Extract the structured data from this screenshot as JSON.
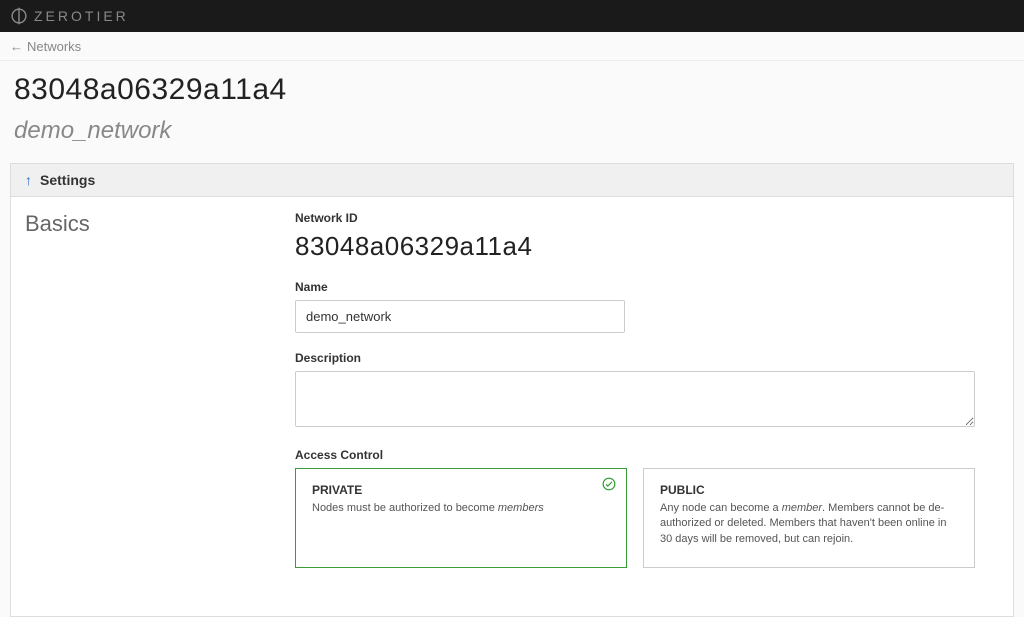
{
  "brand": {
    "name": "ZEROTIER"
  },
  "breadcrumb": {
    "back_label": "Networks"
  },
  "header": {
    "network_id": "83048a06329a11a4",
    "network_name": "demo_network"
  },
  "settings": {
    "heading": "Settings",
    "section": "Basics",
    "fields": {
      "network_id_label": "Network ID",
      "network_id_value": "83048a06329a11a4",
      "name_label": "Name",
      "name_value": "demo_network",
      "description_label": "Description",
      "description_value": "",
      "access_label": "Access Control",
      "access_options": {
        "private": {
          "title": "PRIVATE",
          "desc_prefix": "Nodes must be authorized to become ",
          "desc_em": "members"
        },
        "public": {
          "title": "PUBLIC",
          "desc_prefix": "Any node can become a ",
          "desc_em": "member",
          "desc_suffix": ". Members cannot be de-authorized or deleted. Members that haven't been online in 30 days will be removed, but can rejoin."
        }
      }
    }
  }
}
